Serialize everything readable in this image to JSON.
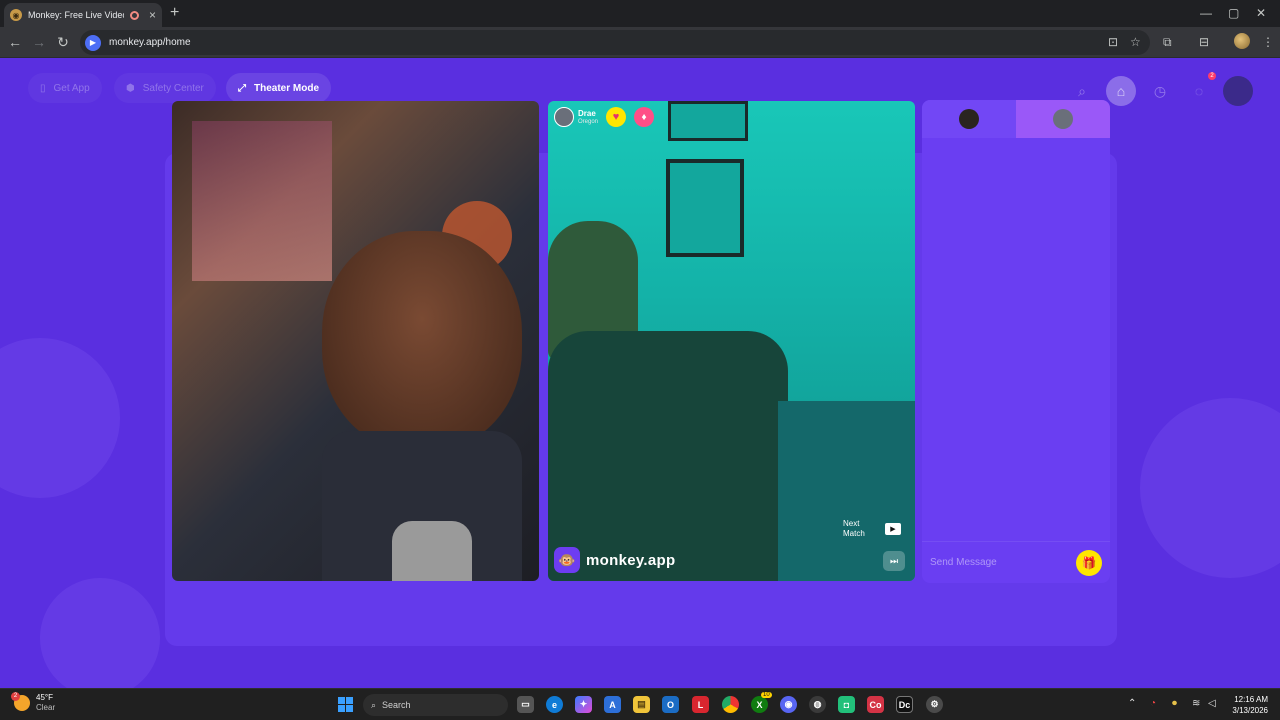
{
  "browser": {
    "tab_title": "Monkey: Free Live Video Ch",
    "url": "monkey.app/home",
    "window_controls": [
      "—",
      "▢",
      "✕"
    ]
  },
  "nav": {
    "get_app": "Get App",
    "safety_center": "Safety Center",
    "theater_mode": "Theater Mode",
    "notification_count": "2"
  },
  "match": {
    "user_name": "Drae",
    "user_location": "Oregon",
    "brand_label": "monkey.app",
    "next_match_label": "Next Match"
  },
  "chat": {
    "placeholder": "Send Message"
  },
  "taskbar": {
    "weather_temp": "45°F",
    "weather_condition": "Clear",
    "weather_badge": "2",
    "search_label": "Search",
    "time": "12:16 AM",
    "date": "3/13/2026",
    "xbox_badge": "10"
  },
  "colors": {
    "page_bg": "#5a2fe0",
    "chat_bg": "#6a3ef2",
    "heart_badge": "#ffe600",
    "accent_pink": "#ff4f87"
  }
}
